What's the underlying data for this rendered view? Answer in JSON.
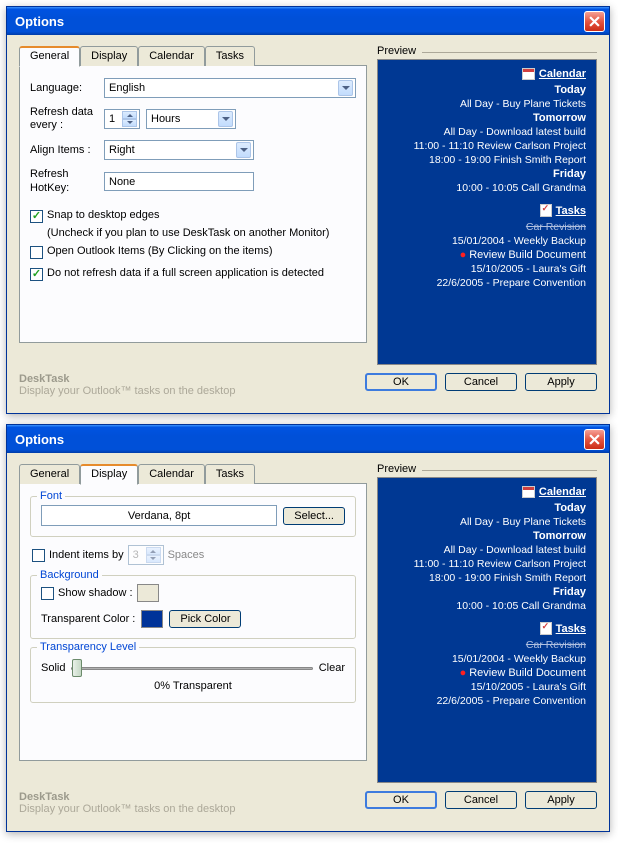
{
  "window_title": "Options",
  "tabs": {
    "general": "General",
    "display": "Display",
    "calendar": "Calendar",
    "tasks": "Tasks"
  },
  "general": {
    "language_label": "Language:",
    "language_value": "English",
    "refresh_label": "Refresh data every :",
    "refresh_value": "1",
    "refresh_unit": "Hours",
    "align_label": "Align Items :",
    "align_value": "Right",
    "hotkey_label": "Refresh HotKey:",
    "hotkey_value": "None",
    "snap_label": "Snap to desktop edges",
    "snap_sub": "(Uncheck if you plan to use DeskTask on another Monitor)",
    "open_label": "Open Outlook Items (By Clicking on the items)",
    "norefresh_label": "Do not refresh data if a full screen application is detected"
  },
  "display": {
    "font_group": "Font",
    "font_value": "Verdana, 8pt",
    "select_btn": "Select...",
    "indent_label": "Indent items by",
    "indent_value": "3",
    "indent_unit": "Spaces",
    "bg_group": "Background",
    "shadow_label": "Show shadow :",
    "transcolor_label": "Transparent Color :",
    "pick_btn": "Pick Color",
    "trans_group": "Transparency Level",
    "solid": "Solid",
    "clear": "Clear",
    "trans_pct": "0% Transparent"
  },
  "preview": {
    "label": "Preview",
    "calendar": "Calendar",
    "today": "Today",
    "today_item": "All Day - Buy Plane Tickets",
    "tomorrow": "Tomorrow",
    "tom_item1": "All Day - Download latest build",
    "tom_item2": "11:00 - 11:10 Review Carlson Project",
    "tom_item3": "18:00 - 19:00 Finish Smith Report",
    "friday": "Friday",
    "fri_item": "10:00 - 10:05 Call Grandma",
    "tasks": "Tasks",
    "task1": "Car Revision",
    "task2": "15/01/2004 - Weekly Backup",
    "task3": "Review Build Document",
    "task4": "15/10/2005 - Laura's Gift",
    "task5": "22/6/2005 - Prepare Convention"
  },
  "footer": {
    "ok": "OK",
    "cancel": "Cancel",
    "apply": "Apply"
  },
  "branding": {
    "name": "DeskTask",
    "tagline": "Display your Outlook™ tasks on the desktop"
  }
}
